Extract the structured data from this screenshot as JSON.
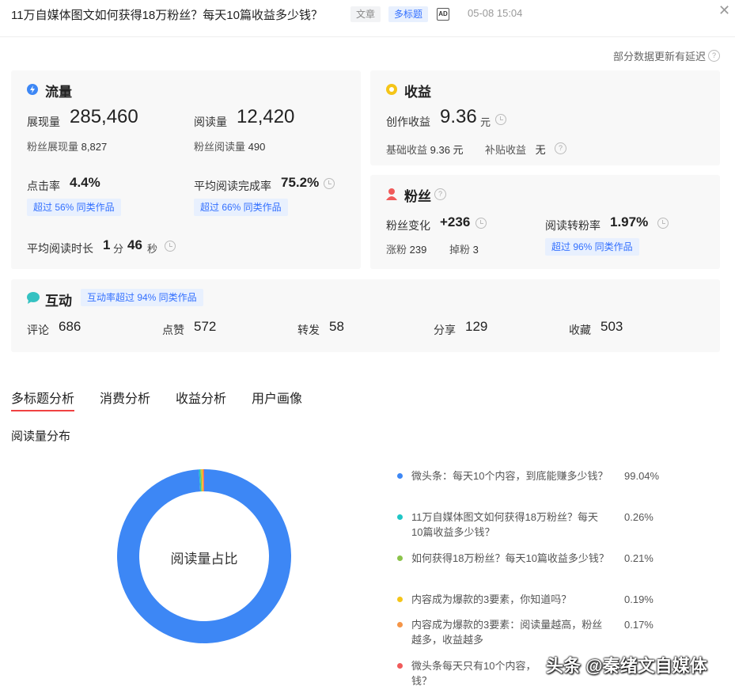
{
  "header": {
    "title": "11万自媒体图文如何获得18万粉丝？每天10篇收益多少钱？",
    "tag_article": "文章",
    "tag_multi": "多标题",
    "ad_label": "AD",
    "publish_time": "05-08 15:04"
  },
  "delay_note": "部分数据更新有延迟",
  "traffic": {
    "title": "流量",
    "impressions_label": "展现量",
    "impressions_value": "285,460",
    "fan_impressions_label": "粉丝展现量",
    "fan_impressions_value": "8,827",
    "reads_label": "阅读量",
    "reads_value": "12,420",
    "fan_reads_label": "粉丝阅读量",
    "fan_reads_value": "490",
    "ctr_label": "点击率",
    "ctr_value": "4.4%",
    "ctr_chip": "超过 56% 同类作品",
    "completion_label": "平均阅读完成率",
    "completion_value": "75.2%",
    "completion_chip": "超过 66% 同类作品",
    "duration_label": "平均阅读时长",
    "duration_min": "1",
    "duration_min_unit": "分",
    "duration_sec": "46",
    "duration_sec_unit": "秒"
  },
  "income": {
    "title": "收益",
    "creation_label": "创作收益",
    "creation_value": "9.36",
    "creation_unit": "元",
    "base_label": "基础收益",
    "base_value": "9.36 元",
    "subsidy_label": "补贴收益",
    "subsidy_value": "无"
  },
  "fans": {
    "title": "粉丝",
    "change_label": "粉丝变化",
    "change_value": "+236",
    "gain_label": "涨粉",
    "gain_value": "239",
    "loss_label": "掉粉",
    "loss_value": "3",
    "conv_label": "阅读转粉率",
    "conv_value": "1.97%",
    "conv_chip": "超过 96% 同类作品"
  },
  "interaction": {
    "title": "互动",
    "chip": "互动率超过 94% 同类作品",
    "items": [
      {
        "label": "评论",
        "value": "686"
      },
      {
        "label": "点赞",
        "value": "572"
      },
      {
        "label": "转发",
        "value": "58"
      },
      {
        "label": "分享",
        "value": "129"
      },
      {
        "label": "收藏",
        "value": "503"
      }
    ]
  },
  "tabs": [
    "多标题分析",
    "消费分析",
    "收益分析",
    "用户画像"
  ],
  "distribution": {
    "section_title": "阅读量分布",
    "center_label": "阅读量占比"
  },
  "chart_data": {
    "type": "pie",
    "categories": [
      "微头条：每天10个内容，到底能赚多少钱？",
      "11万自媒体图文如何获得18万粉丝？每天10篇收益多少钱？",
      "如何获得18万粉丝？每天10篇收益多少钱？",
      "内容成为爆款的3要素，你知道吗？",
      "内容成为爆款的3要素：阅读量越高，粉丝越多，收益越多",
      "微头条每天只有10个内容，"
    ],
    "labels": [
      "99.04%",
      "0.26%",
      "0.21%",
      "0.19%",
      "0.17%",
      ""
    ],
    "values": [
      99.04,
      0.26,
      0.21,
      0.19,
      0.17,
      0.13
    ],
    "colors": [
      "#3d87f5",
      "#1fc6c6",
      "#8bc34a",
      "#f5c518",
      "#f59547",
      "#f05a5a"
    ]
  },
  "legend_tail": "钱？",
  "watermark": "头条 @秦绪文自媒体"
}
